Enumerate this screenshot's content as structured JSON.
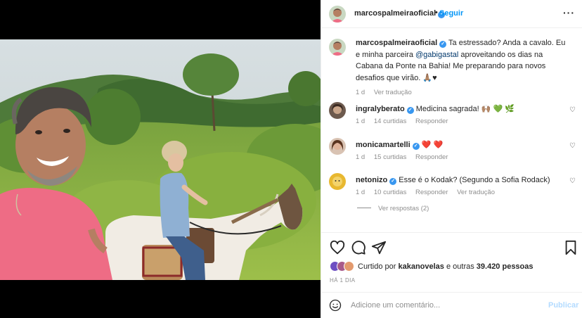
{
  "post": {
    "username": "marcospalmeiraoficial",
    "verified_mark": "✓",
    "separator": "•",
    "follow_label": "Seguir",
    "more_label": "···"
  },
  "caption": {
    "username": "marcospalmeiraoficial",
    "text_before": " Ta estressado? Anda a cavalo. Eu e minha parceira ",
    "mention": "@gabigastal",
    "text_after": " aproveitando os dias na Cabana da Ponte na Bahia! Me preparando para novos desafios que virão. 🙏🏽♥",
    "time": "1 d",
    "translation_label": "Ver tradução"
  },
  "comments": [
    {
      "username": "ingralyberato",
      "text": "Medicina sagrada! 🙌🏽 💚 🌿",
      "time": "1 d",
      "likes": "14 curtidas",
      "reply_label": "Responder",
      "translation_label": ""
    },
    {
      "username": "monicamartelli",
      "text": "❤️ ❤️",
      "time": "1 d",
      "likes": "15 curtidas",
      "reply_label": "Responder",
      "translation_label": ""
    },
    {
      "username": "netonizo",
      "text": "Esse é o Kodak? (Segundo a Sofia Rodack)",
      "time": "1 d",
      "likes": "10 curtidas",
      "reply_label": "Responder",
      "translation_label": "Ver tradução"
    }
  ],
  "view_replies_label": "Ver respostas (2)",
  "likes_summary": {
    "prefix": "Curtido por ",
    "user": "kakanovelas",
    "middle": " e outras ",
    "count": "39.420 pessoas"
  },
  "post_date": "HÁ 1 DIA",
  "comment_box": {
    "placeholder": "Adicione um comentário...",
    "post_label": "Publicar"
  },
  "icons": {
    "like": "heart-icon",
    "comment": "comment-icon",
    "share": "share-icon",
    "save": "bookmark-icon",
    "emoji": "emoji-icon",
    "more": "more-options-icon"
  },
  "colors": {
    "link_blue": "#0095f6",
    "verified_blue": "#3897f0",
    "muted_gray": "#8e8e8e",
    "post_disabled": "#b3dbff"
  }
}
